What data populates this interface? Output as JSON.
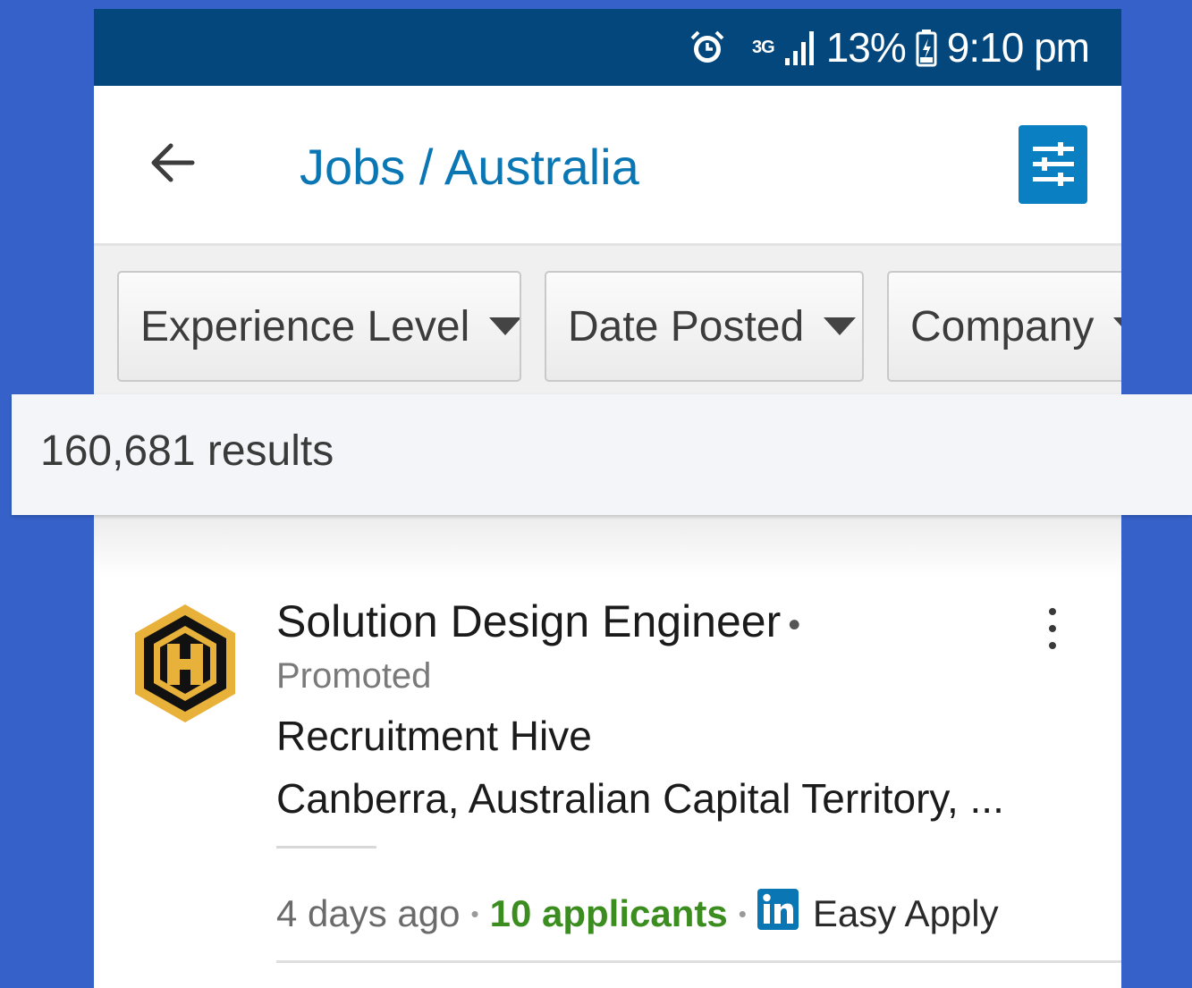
{
  "status_bar": {
    "network": "3G",
    "battery": "13%",
    "time": "9:10 pm"
  },
  "app_bar": {
    "title": "Jobs / Australia"
  },
  "filters": [
    {
      "label": "Experience Level"
    },
    {
      "label": "Date Posted"
    },
    {
      "label": "Company"
    }
  ],
  "results": {
    "count_text": "160,681 results"
  },
  "job": {
    "title": "Solution Design Engineer",
    "promoted": "Promoted",
    "company": "Recruitment Hive",
    "location": "Canberra, Australian Capital Territory, ...",
    "posted": "4 days ago",
    "applicants": "10 applicants",
    "apply_label": "Easy Apply"
  },
  "colors": {
    "background": "#3561c9",
    "status_bar": "#04477c",
    "title_blue": "#0a77b4",
    "filter_button": "#0a80c2",
    "applicants_green": "#3a8d1e",
    "logo_gold": "#e8b13a"
  },
  "icons": {
    "status": [
      "alarm-icon",
      "signal-icon",
      "battery-icon"
    ],
    "back": "arrow-left-icon",
    "filter": "sliders-icon",
    "more": "vertical-dots-icon",
    "linkedin": "linkedin-icon"
  }
}
